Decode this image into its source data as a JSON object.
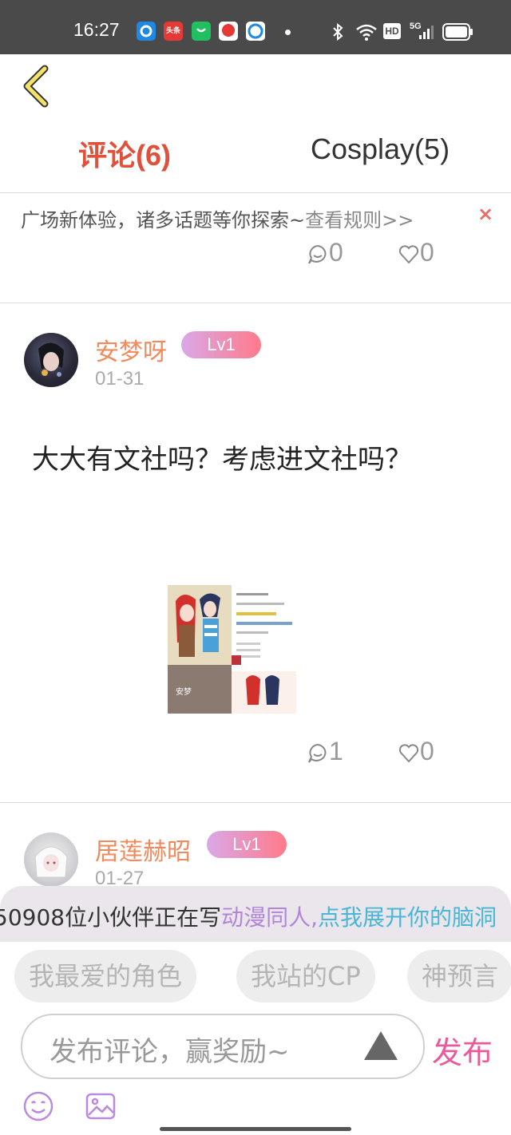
{
  "status_bar": {
    "time": "16:27",
    "apps": [
      {
        "icon": "app-circle-icon",
        "label": "",
        "color": "#1e88e5"
      },
      {
        "icon": "toutiao-icon",
        "label": "头条",
        "color": "#e53935"
      },
      {
        "icon": "shopping-bag-icon",
        "label": "",
        "color": "#20c060"
      },
      {
        "icon": "message-icon",
        "label": "",
        "color": "#e53935"
      },
      {
        "icon": "browser-icon",
        "label": "",
        "color": "#1e88e5"
      }
    ],
    "hd": "HD",
    "network": "5G"
  },
  "tabs": [
    {
      "label": "评论(6)",
      "active": true
    },
    {
      "label": "Cosplay(5)",
      "active": false
    }
  ],
  "notice": {
    "text": "广场新体验，诸多话题等你探索~",
    "link": "查看规则>>",
    "close": "×"
  },
  "top_post_stats": {
    "comments": "0",
    "likes": "0"
  },
  "comments": [
    {
      "username": "安梦呀",
      "level": "Lv1",
      "date": "01-31",
      "text": "大大有文社吗？考虑进文社吗？",
      "image_caption": "安梦",
      "reply_count": "1",
      "like_count": "0"
    },
    {
      "username": "居莲赫昭",
      "level": "Lv1",
      "date": "01-27"
    }
  ],
  "banner": {
    "part1": "50908位小伙伴正在写",
    "part2": "动漫同人,",
    "part3": "点我展开你的脑洞"
  },
  "topic_chips": [
    "我最爱的角色",
    "我站的CP",
    "神预言"
  ],
  "input": {
    "placeholder": "发布评论，赢奖励~",
    "publish_label": "发布"
  },
  "colors": {
    "active_tab": "#e0503a",
    "username": "#f08a5d",
    "publish": "#ea5a9a",
    "banner_purple": "#b185d8",
    "banner_blue": "#4ab6d6"
  }
}
